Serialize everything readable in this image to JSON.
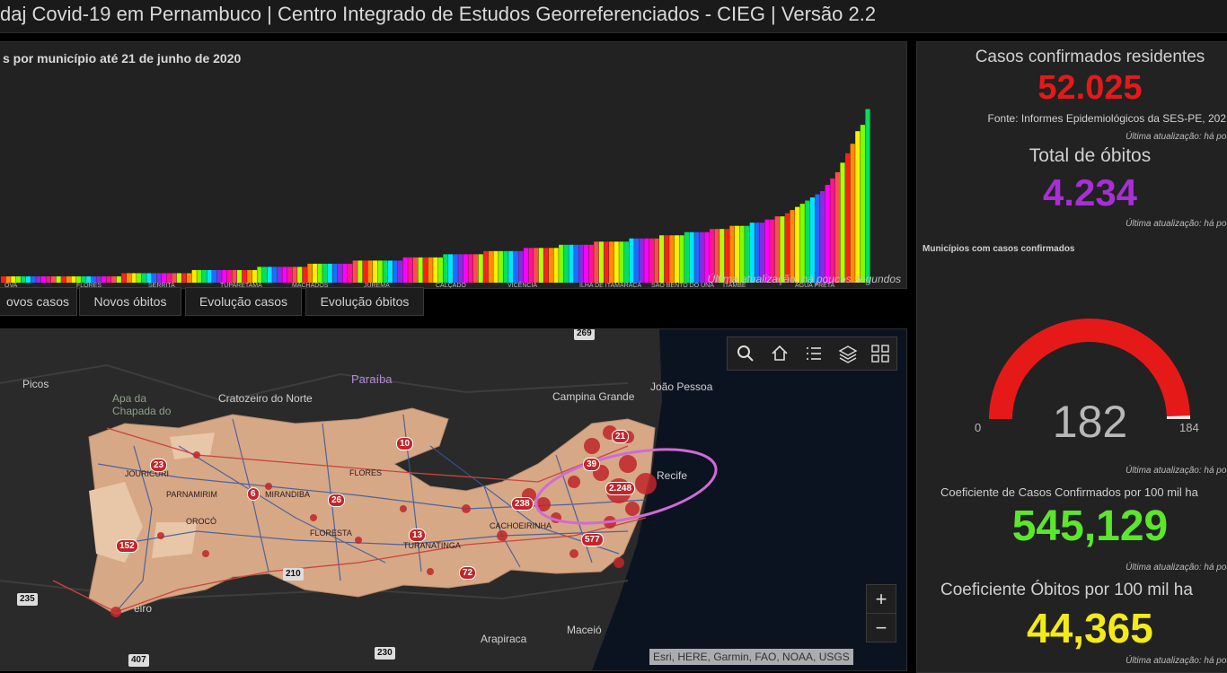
{
  "header": {
    "title": "daj Covid-19 em Pernambuco | Centro Integrado de Estudos Georreferenciados - CIEG | Versão 2.2"
  },
  "colors": {
    "red": "#e61919",
    "purple": "#a82ed6",
    "green": "#5ce62e",
    "yellow": "#f2ea1a",
    "background": "#000000",
    "panel": "#222222"
  },
  "chart_data": {
    "type": "bar",
    "title": "s por município até 21 de junho de 2020",
    "categories": [
      "OVA",
      "FLORES",
      "SERRITA",
      "TUPARETAMA",
      "MACHADOS",
      "JUREMA",
      "CALÇADO",
      "VICÊNCIA",
      "ILHA DE ITAMARACÁ",
      "SÃO BENTO DO UNA",
      "ITAMBÉ",
      "ÁGUA PRETA"
    ],
    "values": [
      2,
      2,
      2,
      2,
      2,
      2,
      2,
      2,
      2,
      2,
      2,
      2,
      2,
      2,
      2,
      2,
      2,
      2,
      2,
      2,
      2,
      2,
      2,
      2,
      3,
      3,
      3,
      3,
      3,
      3,
      3,
      3,
      3,
      3,
      3,
      3,
      3,
      3,
      4,
      4,
      4,
      4,
      4,
      4,
      4,
      4,
      4,
      4,
      4,
      4,
      4,
      5,
      5,
      5,
      5,
      5,
      5,
      5,
      5,
      5,
      5,
      6,
      6,
      6,
      6,
      6,
      6,
      6,
      6,
      6,
      7,
      7,
      7,
      7,
      7,
      7,
      7,
      7,
      7,
      7,
      8,
      8,
      8,
      8,
      8,
      8,
      8,
      8,
      9,
      9,
      9,
      9,
      9,
      9,
      9,
      9,
      10,
      10,
      10,
      10,
      10,
      10,
      10,
      10,
      11,
      11,
      11,
      11,
      11,
      11,
      11,
      12,
      12,
      12,
      12,
      12,
      12,
      12,
      13,
      13,
      13,
      13,
      13,
      13,
      13,
      14,
      14,
      14,
      14,
      14,
      14,
      15,
      15,
      15,
      15,
      15,
      16,
      16,
      16,
      16,
      16,
      17,
      17,
      17,
      17,
      18,
      18,
      18,
      18,
      19,
      19,
      19,
      20,
      20,
      21,
      21,
      22,
      23,
      24,
      25,
      26,
      27,
      28,
      29,
      31,
      33,
      35,
      38,
      41,
      44,
      48,
      50,
      55
    ],
    "ylim": [
      0,
      58
    ],
    "grid": false,
    "legend": "none"
  },
  "chart_panel": {
    "updated": "Última atualização: há poucos segundos"
  },
  "tabs": [
    "ovos casos",
    "Novos óbitos",
    "Evolução casos",
    "Evolução óbitos"
  ],
  "map": {
    "attribution": "Esri, HERE, Garmin, FAO, NOAA, USGS",
    "labels": [
      "Picos",
      "Apa da Chapada do",
      "Cratozeiro do Norte",
      "Paraíba",
      "Campina Grande",
      "João Pessoa",
      "Recife",
      "Maceió",
      "Arapiraca",
      "eiro"
    ],
    "shields": [
      "269",
      "230",
      "210",
      "235",
      "407"
    ],
    "towns": [
      "JOURICURI",
      "PARNAMIRIM",
      "OROCÓ",
      "MIRANDIBA",
      "FLORESTA",
      "FLORES",
      "TURANATINGA",
      "CACHOEIRINHA"
    ],
    "badges": [
      "21",
      "39",
      "2.248",
      "577",
      "10",
      "23",
      "6",
      "26",
      "13",
      "238",
      "152",
      "72"
    ],
    "zoom_in": "+",
    "zoom_out": "−",
    "tools": [
      "search-icon",
      "home-icon",
      "legend-icon",
      "layers-icon",
      "basemap-icon"
    ]
  },
  "side": {
    "cases": {
      "title": "Casos confirmados residentes",
      "value": "52.025",
      "source": "Fonte: Informes Epidemiológicos da SES-PE, 202",
      "updated": "Última atualização: há poucos segu"
    },
    "deaths": {
      "title": "Total de óbitos",
      "value": "4.234",
      "updated": "Última atualização: há poucos segu"
    },
    "municipalities": {
      "title": "Municípios com casos confirmados",
      "value": "182",
      "min": "0",
      "max": "184",
      "fraction": 0.989,
      "updated": "Última atualização: há poucos segu"
    },
    "case_rate": {
      "title": "Coeficiente de Casos Confirmados por 100 mil ha",
      "value": "545,129",
      "updated": "Última atualização: há poucos segu"
    },
    "death_rate": {
      "title": "Coeficiente Óbitos por 100 mil ha",
      "value": "44,365",
      "updated": "Última atualização: há poucos segu"
    }
  }
}
